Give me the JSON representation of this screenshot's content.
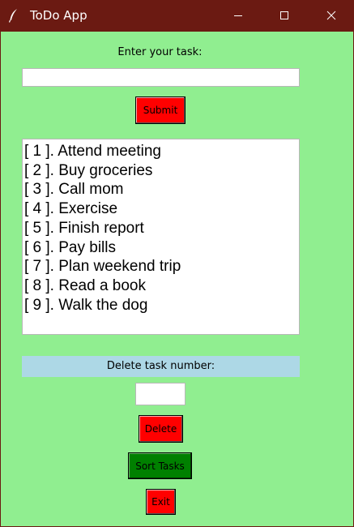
{
  "window": {
    "title": "ToDo App",
    "icon": "feather-icon",
    "controls": [
      "minimize-icon",
      "maximize-icon",
      "close-icon"
    ],
    "colors": {
      "titlebar": "#6b1a12",
      "background": "#90ee90",
      "button_red": "#ff0000",
      "button_green": "#008000",
      "delete_label_bg": "#add8e6"
    }
  },
  "task_entry": {
    "label": "Enter your task:",
    "value": "",
    "submit_label": "Submit"
  },
  "tasks": [
    "[ 1 ]. Attend meeting",
    "[ 2 ]. Buy groceries",
    "[ 3 ]. Call mom",
    "[ 4 ]. Exercise",
    "[ 5 ]. Finish report",
    "[ 6 ]. Pay bills",
    "[ 7 ]. Plan weekend trip",
    "[ 8 ]. Read a book",
    "[ 9 ]. Walk the dog"
  ],
  "delete": {
    "label": "Delete task number:",
    "value": "",
    "button_label": "Delete"
  },
  "sort_label": "Sort Tasks",
  "exit_label": "Exit"
}
